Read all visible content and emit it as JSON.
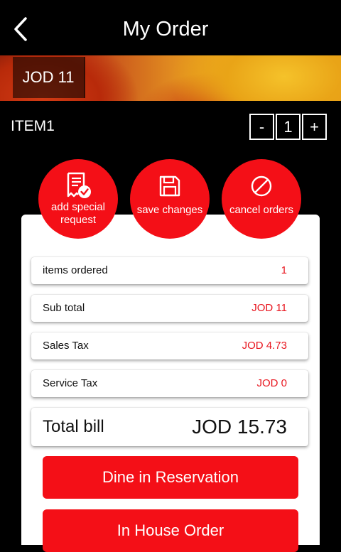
{
  "header": {
    "title": "My Order",
    "back_icon": "chevron-left-icon"
  },
  "banner": {
    "price": "JOD 11"
  },
  "item": {
    "name": "ITEM1",
    "minus": "-",
    "quantity": "1",
    "plus": "+"
  },
  "actions": [
    {
      "label_line1": "add special",
      "label_line2": "request",
      "icon": "note-check-icon"
    },
    {
      "label": "save changes",
      "icon": "floppy-disk-icon"
    },
    {
      "label": "cancel orders",
      "icon": "prohibited-icon"
    }
  ],
  "summary": {
    "items_ordered": {
      "label": "items ordered",
      "value": "1"
    },
    "sub_total": {
      "label": "Sub total",
      "value": "JOD 11"
    },
    "sales_tax": {
      "label": "Sales Tax",
      "value": "JOD 4.73"
    },
    "service_tax": {
      "label": "Service Tax",
      "value": "JOD 0"
    },
    "total_bill": {
      "label": "Total bill",
      "value": "JOD 15.73"
    }
  },
  "buttons": {
    "dine_in": "Dine in Reservation",
    "in_house": "In House Order"
  },
  "colors": {
    "accent": "#f40f17",
    "value_red": "#e8151e",
    "background": "#000000"
  }
}
